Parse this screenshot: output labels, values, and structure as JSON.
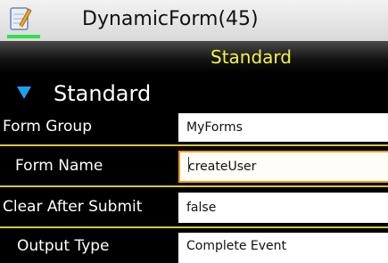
{
  "titlebar": {
    "app_icon": "pencil-notepad-icon",
    "title": "DynamicForm(45)"
  },
  "tabbar": {
    "active_tab": "Standard",
    "accent_color": "#f7f246"
  },
  "section": {
    "icon": "triangle-down-icon",
    "title": "Standard"
  },
  "fields": [
    {
      "label": "Form Group",
      "value": "MyForms"
    },
    {
      "label": "Form Name",
      "value": "createUser",
      "focused": true
    },
    {
      "label": "Clear After Submit",
      "value": "false"
    },
    {
      "label": "Output Type",
      "value": "Complete Event"
    }
  ],
  "colors": {
    "focus_border": "#f39b1a",
    "row_separator": "#d8c63a"
  }
}
